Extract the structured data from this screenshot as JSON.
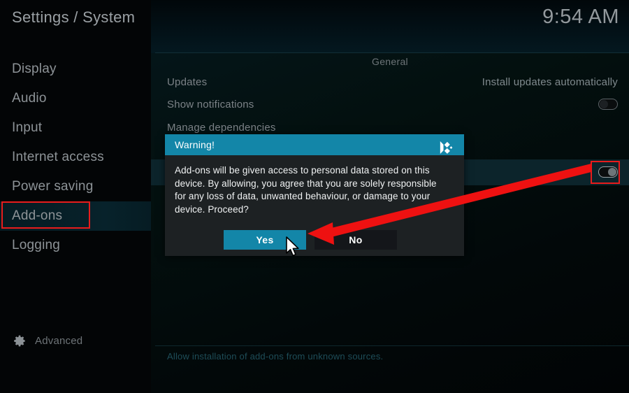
{
  "header": {
    "title": "Settings / System",
    "clock": "9:54 AM"
  },
  "sidebar": {
    "items": [
      {
        "label": "Display",
        "selected": false
      },
      {
        "label": "Audio",
        "selected": false
      },
      {
        "label": "Input",
        "selected": false
      },
      {
        "label": "Internet access",
        "selected": false
      },
      {
        "label": "Power saving",
        "selected": false
      },
      {
        "label": "Add-ons",
        "selected": true
      },
      {
        "label": "Logging",
        "selected": false
      }
    ],
    "advanced": {
      "label": "Advanced",
      "icon": "gear-icon"
    }
  },
  "main": {
    "group_header": "General",
    "rows": [
      {
        "label": "Updates",
        "value": "Install updates automatically",
        "control": "text"
      },
      {
        "label": "Show notifications",
        "value": "",
        "control": "toggle-off"
      },
      {
        "label": "Manage dependencies",
        "value": "",
        "control": "none"
      },
      {
        "label": "",
        "value": "",
        "control": "toggle-unknown-sources"
      }
    ],
    "footer_description": "Allow installation of add-ons from unknown sources."
  },
  "dialog": {
    "title": "Warning!",
    "logo": "kodi-logo",
    "message": "Add-ons will be given access to personal data stored on this device. By allowing, you agree that you are solely responsible for any loss of data, unwanted behaviour, or damage to your device. Proceed?",
    "buttons": [
      {
        "label": "Yes",
        "focused": true
      },
      {
        "label": "No",
        "focused": false
      }
    ]
  },
  "annotations": {
    "accent_color": "#e81c1c",
    "arrow": "points from the unknown-sources toggle to the Yes button",
    "boxes": [
      "sidebar Add-ons item",
      "unknown sources toggle"
    ]
  },
  "colors": {
    "accent": "#1386a8",
    "annotation_red": "#e81c1c",
    "text_muted": "#7c8287",
    "panel_bg": "#030506"
  }
}
